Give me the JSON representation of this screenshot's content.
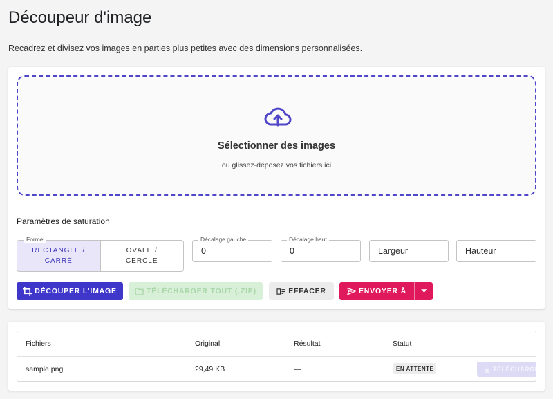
{
  "page": {
    "title": "Découpeur d'image",
    "subtitle": "Recadrez et divisez vos images en parties plus petites avec des dimensions personnalisées."
  },
  "dropzone": {
    "icon": "cloud-upload-icon",
    "title": "Sélectionner des images",
    "hint": "ou glissez-déposez vos fichiers ici"
  },
  "params": {
    "label": "Paramètres de saturation",
    "shape": {
      "legend": "Forme",
      "options": [
        "RECTANGLE / CARRÉ",
        "OVALE / CERCLE"
      ],
      "selected": "RECTANGLE / CARRÉ"
    },
    "offset_left": {
      "legend": "Décalage gauche",
      "value": "0"
    },
    "offset_top": {
      "legend": "Décalage haut",
      "value": "0"
    },
    "width": {
      "placeholder": "Largeur"
    },
    "height": {
      "placeholder": "Hauteur"
    }
  },
  "actions": {
    "crop": "DÉCOUPER L'IMAGE",
    "download_zip": "TÉLÉCHARGER TOUT (.ZIP)",
    "clear": "EFFACER",
    "send": "ENVOYER À"
  },
  "files_table": {
    "headers": [
      "Fichiers",
      "Original",
      "Résultat",
      "Statut"
    ],
    "rows": [
      {
        "name": "sample.png",
        "original": "29,49 KB",
        "result": "—",
        "status": "EN ATTENTE",
        "action": "TÉLÉCHARGER"
      }
    ]
  },
  "colors": {
    "primary": "#3f37c9",
    "accent": "#e0195d",
    "dropzone_border": "#4f46c8",
    "zip_disabled": "#d8efd8"
  }
}
